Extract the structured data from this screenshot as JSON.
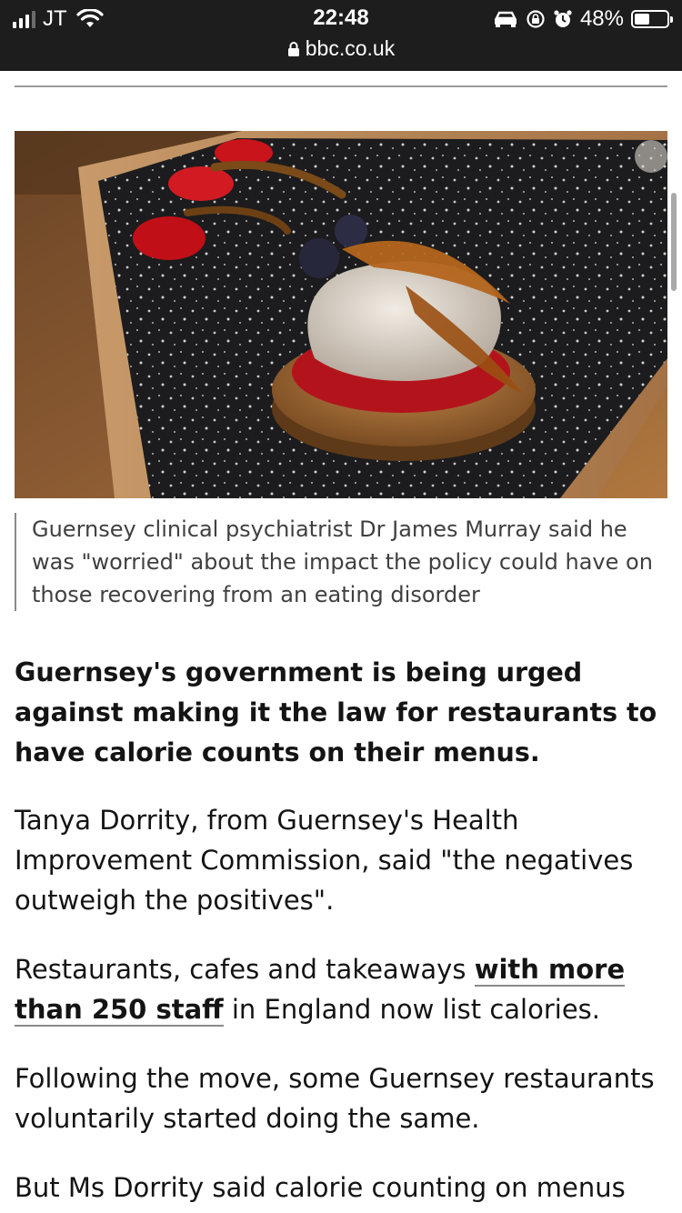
{
  "status_bar": {
    "carrier": "JT",
    "time": "22:48",
    "url": "bbc.co.uk",
    "battery_percent": "48%",
    "battery_level": 0.48,
    "icons": [
      "signal-icon",
      "wifi-icon",
      "lock-icon",
      "car-icon",
      "rotation-lock-icon",
      "alarm-icon",
      "battery-icon"
    ]
  },
  "figure": {
    "image_subject": "dessert-on-slate-photo",
    "caption": "Guernsey clinical psychiatrist Dr James Murray said he was \"worried\" about the impact the policy could have on those recovering from an eating disorder"
  },
  "article": {
    "lead": "Guernsey's government is being urged against making it the law for restaurants to have calorie counts on their menus.",
    "p1": "Tanya Dorrity, from Guernsey's Health Improvement Commission, said \"the negatives outweigh the positives\".",
    "p2_before": "Restaurants, cafes and takeaways ",
    "p2_link": "with more than 250 staff",
    "p2_after": " in England now list calories.",
    "p3": "Following the move, some Guernsey restaurants voluntarily started doing the same.",
    "p4": "But Ms Dorrity said calorie counting on menus"
  },
  "colors": {
    "status_bar_bg": "#1d1d1d",
    "text": "#141414",
    "caption_text": "#404040",
    "rule": "#9a9a9a"
  }
}
